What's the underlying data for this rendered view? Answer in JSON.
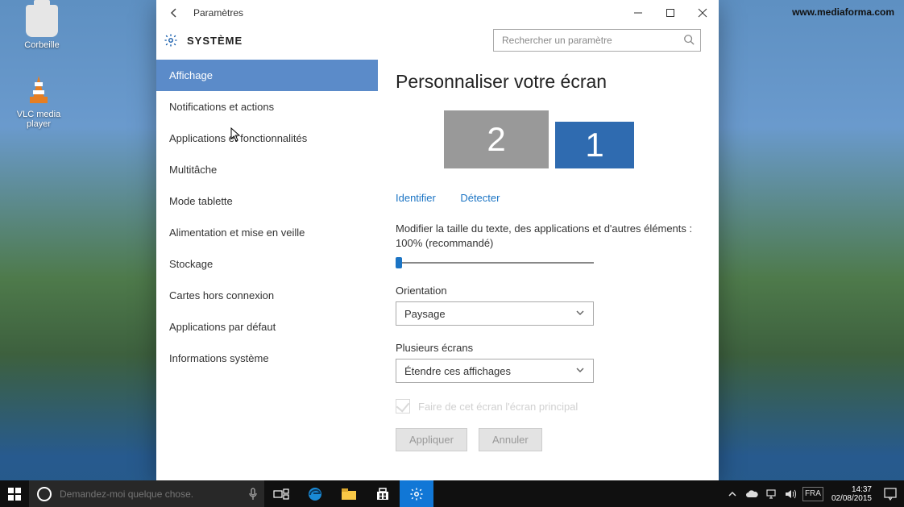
{
  "watermark": "www.mediaforma.com",
  "desktop_icons": {
    "recycle": "Corbeille",
    "vlc": "VLC media player"
  },
  "window": {
    "title": "Paramètres",
    "header": "SYSTÈME",
    "search": {
      "placeholder": "Rechercher un paramètre"
    },
    "nav": {
      "items": [
        "Affichage",
        "Notifications et actions",
        "Applications et fonctionnalités",
        "Multitâche",
        "Mode tablette",
        "Alimentation et mise en veille",
        "Stockage",
        "Cartes hors connexion",
        "Applications par défaut",
        "Informations système"
      ],
      "active_index": 0
    },
    "content": {
      "heading": "Personnaliser votre écran",
      "monitors": {
        "m2": "2",
        "m1": "1"
      },
      "links": {
        "identify": "Identifier",
        "detect": "Détecter"
      },
      "scale_label": "Modifier la taille du texte, des applications et d'autres éléments : 100% (recommandé)",
      "orientation": {
        "label": "Orientation",
        "value": "Paysage"
      },
      "multi": {
        "label": "Plusieurs écrans",
        "value": "Étendre ces affichages"
      },
      "main_check": "Faire de cet écran l'écran principal",
      "buttons": {
        "apply": "Appliquer",
        "cancel": "Annuler"
      }
    }
  },
  "taskbar": {
    "cortana_placeholder": "Demandez-moi quelque chose.",
    "clock": {
      "time": "14:37",
      "date": "02/08/2015"
    }
  }
}
